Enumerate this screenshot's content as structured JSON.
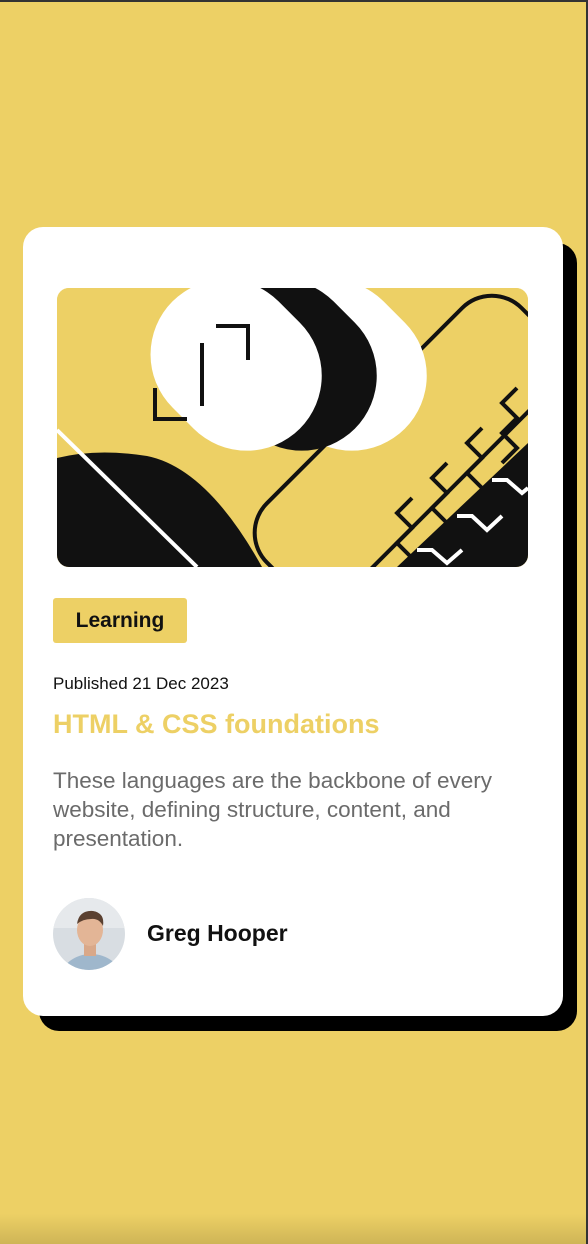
{
  "card": {
    "tag": "Learning",
    "published": "Published 21 Dec 2023",
    "title": "HTML & CSS foundations",
    "description": "These languages are the backbone of every website, defining structure, content, and presentation.",
    "author": "Greg Hooper"
  },
  "colors": {
    "background": "#EDD065",
    "card": "#FFFFFF",
    "shadow": "#000000",
    "text_primary": "#111111",
    "text_secondary": "#6B6B6B",
    "accent": "#EDD065"
  },
  "icons": {
    "hero": "abstract-illustration-icon",
    "avatar": "person-photo-icon"
  }
}
